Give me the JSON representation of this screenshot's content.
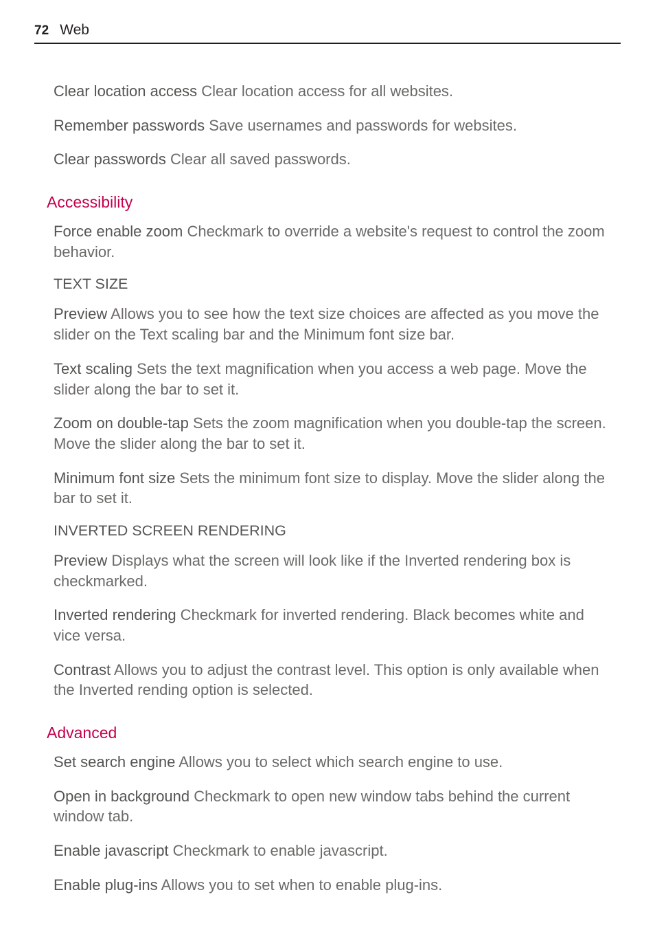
{
  "header": {
    "page_number": "72",
    "title": "Web"
  },
  "intro": {
    "p1_label": "Clear location access",
    "p1_text": " Clear location access for all websites.",
    "p2_label": "Remember passwords",
    "p2_text": " Save usernames and passwords for websites.",
    "p3_label": "Clear passwords",
    "p3_text": " Clear all saved passwords."
  },
  "accessibility": {
    "heading": "Accessibility",
    "p1_label": "Force enable zoom",
    "p1_text": "  Checkmark to override a website's request to control the zoom behavior.",
    "sub1": "TEXT SIZE",
    "p2_label": "Preview",
    "p2_text": "  Allows you to see how the text size choices are affected as you move the slider on the Text scaling bar and the Minimum font size bar.",
    "p3_label": "Text scaling",
    "p3_text": "  Sets the text magnification when you access a web page. Move the slider along the bar to set it.",
    "p4_label": "Zoom on double-tap",
    "p4_text": "  Sets the zoom magnification when you double-tap the screen.  Move the slider along the bar to set it.",
    "p5_label": "Minimum font size",
    "p5_text": "  Sets the minimum font size to display.  Move the slider along the bar to set it.",
    "sub2": "INVERTED SCREEN RENDERING",
    "p6_label": "Preview",
    "p6_text": "  Displays what the screen will look like if the Inverted rendering box is checkmarked.",
    "p7_label": "Inverted rendering",
    "p7_text": "  Checkmark for inverted rendering. Black becomes white and vice versa.",
    "p8_label": "Contrast",
    "p8_text": "  Allows you to adjust the contrast level. This option is only available when the Inverted rending option is selected."
  },
  "advanced": {
    "heading": "Advanced",
    "p1_label": "Set search engine",
    "p1_text": "  Allows you to select which search engine to use.",
    "p2_label": "Open in background",
    "p2_text": "  Checkmark to open new window tabs behind the current window tab.",
    "p3_label": "Enable javascript",
    "p3_text": "  Checkmark to enable javascript.",
    "p4_label": "Enable plug-ins",
    "p4_text": "  Allows you to set when to enable plug-ins."
  }
}
